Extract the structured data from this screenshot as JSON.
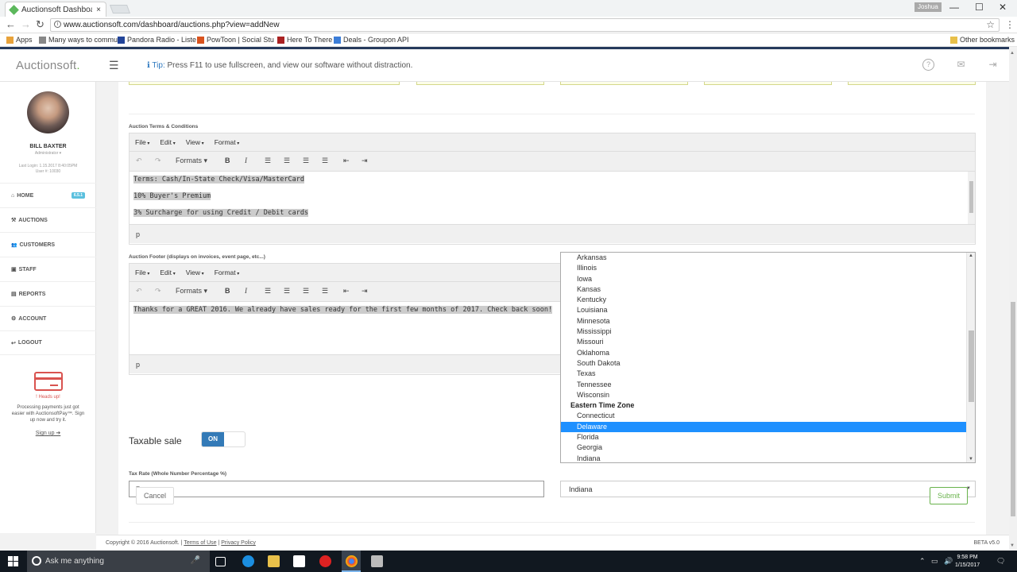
{
  "browser": {
    "tab_title": "Auctionsoft Dashboard |",
    "tab_close": "×",
    "user_chip": "Joshua",
    "url": "www.auctionsoft.com/dashboard/auctions.php?view=addNew",
    "window_controls": [
      "—",
      "☐",
      "✕"
    ],
    "bookmarks": [
      {
        "label": "Apps",
        "color": "#e8a23a"
      },
      {
        "label": "Many ways to commu",
        "color": "#888888"
      },
      {
        "label": "Pandora Radio - Liste",
        "color": "#224499"
      },
      {
        "label": "PowToon | Social Stu",
        "color": "#d9531e"
      },
      {
        "label": "Here To There",
        "color": "#aa2222"
      },
      {
        "label": "Deals - Groupon API",
        "color": "#3b7dd8"
      }
    ],
    "other_bookmarks": "Other bookmarks"
  },
  "header": {
    "brand": "Auctionsoft",
    "brand_dot": ".",
    "tip_prefix": "Tip:",
    "tip_text": "Press F11 to use fullscreen, and view our software without distraction."
  },
  "sidebar": {
    "user_name": "BILL BAXTER",
    "user_role": "Administrator ▾",
    "last_login": "Last Login: 1.15.2017 8:40:05PM",
    "user_number": "User #: 10030",
    "nav": [
      {
        "icon": "⌂",
        "label": "HOME",
        "badge": "6.5.1"
      },
      {
        "icon": "⚒",
        "label": "AUCTIONS"
      },
      {
        "icon": "👥",
        "label": "CUSTOMERS"
      },
      {
        "icon": "▣",
        "label": "STAFF"
      },
      {
        "icon": "▤",
        "label": "REPORTS"
      },
      {
        "icon": "⚙",
        "label": "ACCOUNT"
      },
      {
        "icon": "↩",
        "label": "LOGOUT"
      }
    ],
    "promo_heading": "! Heads up!",
    "promo_text": "Processing payments just got easier with AuctionsoftPay™. Sign up now and try it.",
    "promo_link": "Sign up ➔"
  },
  "form": {
    "terms_label": "Auction Terms & Conditions",
    "footer_label": "Auction Footer (displays on invoices, event page, etc...)",
    "editor_menu": [
      "File",
      "Edit",
      "View",
      "Format"
    ],
    "formats_label": "Formats ▾",
    "terms_lines": [
      "Terms: Cash/In-State Check/Visa/MasterCard",
      "10% Buyer's Premium",
      "3% Surcharge for using Credit / Debit cards"
    ],
    "footer_text": "Thanks for a GREAT 2016.  We already have sales ready for the first few months of 2017.  Check back soon!",
    "status_path": "p",
    "taxable_label": "Taxable sale",
    "toggle_on": "ON",
    "tax_rate_label": "Tax Rate (Whole Number Percentage %)",
    "tax_rate_value": "7",
    "state_value": "Indiana",
    "cancel": "Cancel",
    "submit": "Submit"
  },
  "dropdown": {
    "items": [
      {
        "type": "opt",
        "label": "Arkansas"
      },
      {
        "type": "opt",
        "label": "Illinois"
      },
      {
        "type": "opt",
        "label": "Iowa"
      },
      {
        "type": "opt",
        "label": "Kansas"
      },
      {
        "type": "opt",
        "label": "Kentucky"
      },
      {
        "type": "opt",
        "label": "Louisiana"
      },
      {
        "type": "opt",
        "label": "Minnesota"
      },
      {
        "type": "opt",
        "label": "Mississippi"
      },
      {
        "type": "opt",
        "label": "Missouri"
      },
      {
        "type": "opt",
        "label": "Oklahoma"
      },
      {
        "type": "opt",
        "label": "South Dakota"
      },
      {
        "type": "opt",
        "label": "Texas"
      },
      {
        "type": "opt",
        "label": "Tennessee"
      },
      {
        "type": "opt",
        "label": "Wisconsin"
      },
      {
        "type": "group",
        "label": "Eastern Time Zone"
      },
      {
        "type": "opt",
        "label": "Connecticut"
      },
      {
        "type": "opt",
        "label": "Delaware",
        "selected": true
      },
      {
        "type": "opt",
        "label": "Florida"
      },
      {
        "type": "opt",
        "label": "Georgia"
      },
      {
        "type": "opt",
        "label": "Indiana"
      }
    ]
  },
  "footer": {
    "copyright": "Copyright © 2016 Auctionsoft.",
    "terms": "Terms of Use",
    "privacy": "Privacy Policy",
    "version": "BETA v5.0"
  },
  "taskbar": {
    "search_placeholder": "Ask me anything",
    "time": "9:58 PM",
    "date": "1/15/2017"
  }
}
